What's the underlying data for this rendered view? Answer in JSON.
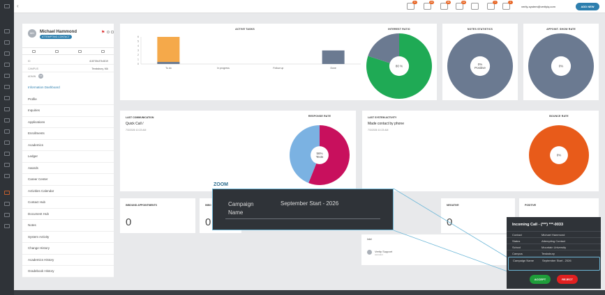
{
  "topbar": {
    "user": "verity-system@verityiq.com",
    "add_new": "ADD NEW",
    "badges": [
      "3",
      "16",
      "99",
      "12",
      "",
      "7",
      "1"
    ]
  },
  "student": {
    "initials": "MH",
    "name": "Michael Hammond",
    "status": "ATTEMPTING CONTACT",
    "id_label": "ID",
    "id_value": "418739c37b4819",
    "campus_label": "CAMPUS",
    "campus_value": "Tewksbury, MA",
    "admin_label": "ADMIN",
    "admin_value": "VS"
  },
  "nav": [
    "Information Dashboard",
    "Profile",
    "Inquiries",
    "Applications",
    "Enrollments",
    "Academics",
    "Ledger",
    "Awards",
    "Career Center",
    "Activities Calendar",
    "Contact Hub",
    "Document Hub",
    "Notes",
    "System Activity",
    "Change History",
    "Academics History",
    "Gradebook History"
  ],
  "active_tasks": {
    "title": "ACTIVE TASKS",
    "y_ticks": [
      "6",
      "5",
      "4",
      "3",
      "2",
      "1",
      "0"
    ]
  },
  "chart_data": [
    {
      "type": "bar",
      "title": "ACTIVE TASKS",
      "categories": [
        "To do",
        "In progress",
        "Follow up",
        "Done"
      ],
      "values": [
        6,
        0,
        0,
        3
      ],
      "ylim": [
        0,
        6
      ],
      "colors": [
        "#f5a94a",
        "#5a6573",
        "#5a6573",
        "#6b7a91"
      ]
    },
    {
      "type": "pie",
      "title": "INTEREST RATIO",
      "center_label": "80 %",
      "values": [
        80,
        20
      ],
      "colors": [
        "#1faa55",
        "#6b7a91"
      ]
    },
    {
      "type": "pie",
      "title": "NOTES STATISTICS",
      "center_label": "0% Positive",
      "values": [
        100
      ],
      "colors": [
        "#6b7a91"
      ]
    },
    {
      "type": "pie",
      "title": "APPOINT. SHOW RATE",
      "center_label": "0%",
      "values": [
        100
      ],
      "colors": [
        "#6b7a91"
      ]
    },
    {
      "type": "pie",
      "title": "RESPONSE RATE",
      "center_label": "56% Texts",
      "values": [
        56,
        44
      ],
      "colors": [
        "#c8105d",
        "#7bb2e2"
      ]
    },
    {
      "type": "pie",
      "title": "BOUNCE RATE",
      "center_label": "0%",
      "values": [
        100
      ],
      "colors": [
        "#e85b1a"
      ]
    }
  ],
  "interest": {
    "title": "INTEREST RATIO",
    "center": "80 %"
  },
  "notes": {
    "title": "NOTES STATISTICS",
    "center": "0% Positive"
  },
  "appoint": {
    "title": "APPOINT. SHOW RATE",
    "center": "0%"
  },
  "last_comm": {
    "title": "LAST COMMUNICATION",
    "main": "Quick Call /",
    "date": "7/3/2026 10:23 AM"
  },
  "response": {
    "title": "RESPONSE RATE",
    "center1": "56%",
    "center2": "Texts"
  },
  "last_activity": {
    "title": "LAST SYSTEM ACTIVITY",
    "main": "Made contact by phone",
    "date": "7/3/2026 10:23 AM"
  },
  "bounce": {
    "title": "BOUNCE RATE",
    "center": "0%"
  },
  "inbound": {
    "title": "INBOUND APPOINTMENTS",
    "value": "0"
  },
  "second": {
    "title": "INBO",
    "value": "0"
  },
  "negative": {
    "title": "NEGATIVE",
    "value": "0"
  },
  "positive": {
    "title": "POSITIVE"
  },
  "note_panel": {
    "label": "Intel",
    "author": "Verity Support",
    "sub": "assistant"
  },
  "zoom": {
    "label": "ZOOM",
    "key": "Campaign Name",
    "value": "September Start - 2026"
  },
  "call": {
    "title": "Incoming Call - (***) ***-0033",
    "rows": [
      {
        "k": "Contact",
        "v": "Michael Hammond"
      },
      {
        "k": "Status",
        "v": "Attempting Contact"
      },
      {
        "k": "School",
        "v": "Mountain University"
      },
      {
        "k": "Campus",
        "v": "Tewksbury"
      }
    ],
    "campaign_k": "Campaign Name",
    "campaign_v": "September Start - 2026",
    "accept": "ACCEPT",
    "reject": "REJECT"
  }
}
